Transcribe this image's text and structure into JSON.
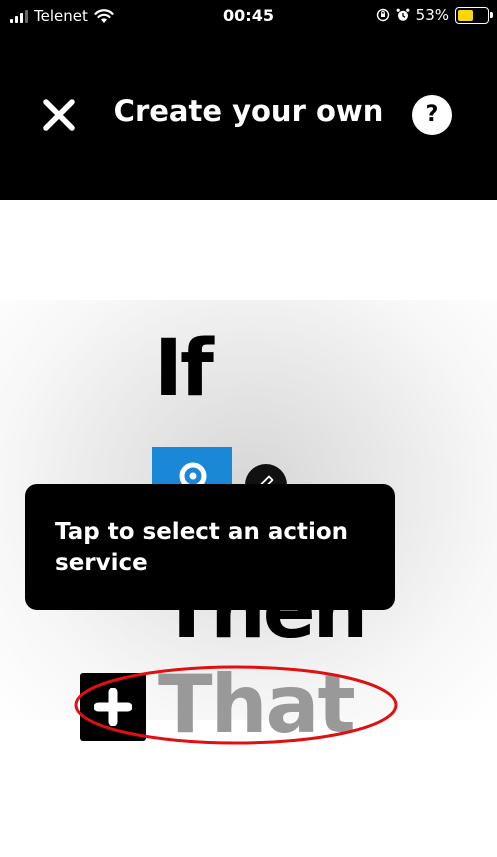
{
  "status_bar": {
    "carrier": "Telenet",
    "time": "00:45",
    "battery_percent": "53%",
    "battery_level": 0.53,
    "battery_color": "#ffd60a",
    "icons": [
      "signal-icon",
      "wifi-icon",
      "orientation-lock-icon",
      "alarm-icon",
      "battery-icon"
    ]
  },
  "header": {
    "title": "Create your own",
    "close_icon": "close-icon",
    "help_label": "?"
  },
  "builder": {
    "if_label": "If",
    "trigger_service_icon": "service-logo-icon",
    "trigger_service_color": "#1a88d6",
    "edit_icon": "pencil-icon",
    "then_label": "Then",
    "add_icon": "plus-icon",
    "that_label": "That",
    "that_color": "#999999",
    "highlight_color": "#e01010"
  },
  "tooltip": {
    "text": "Tap to select an action service"
  }
}
